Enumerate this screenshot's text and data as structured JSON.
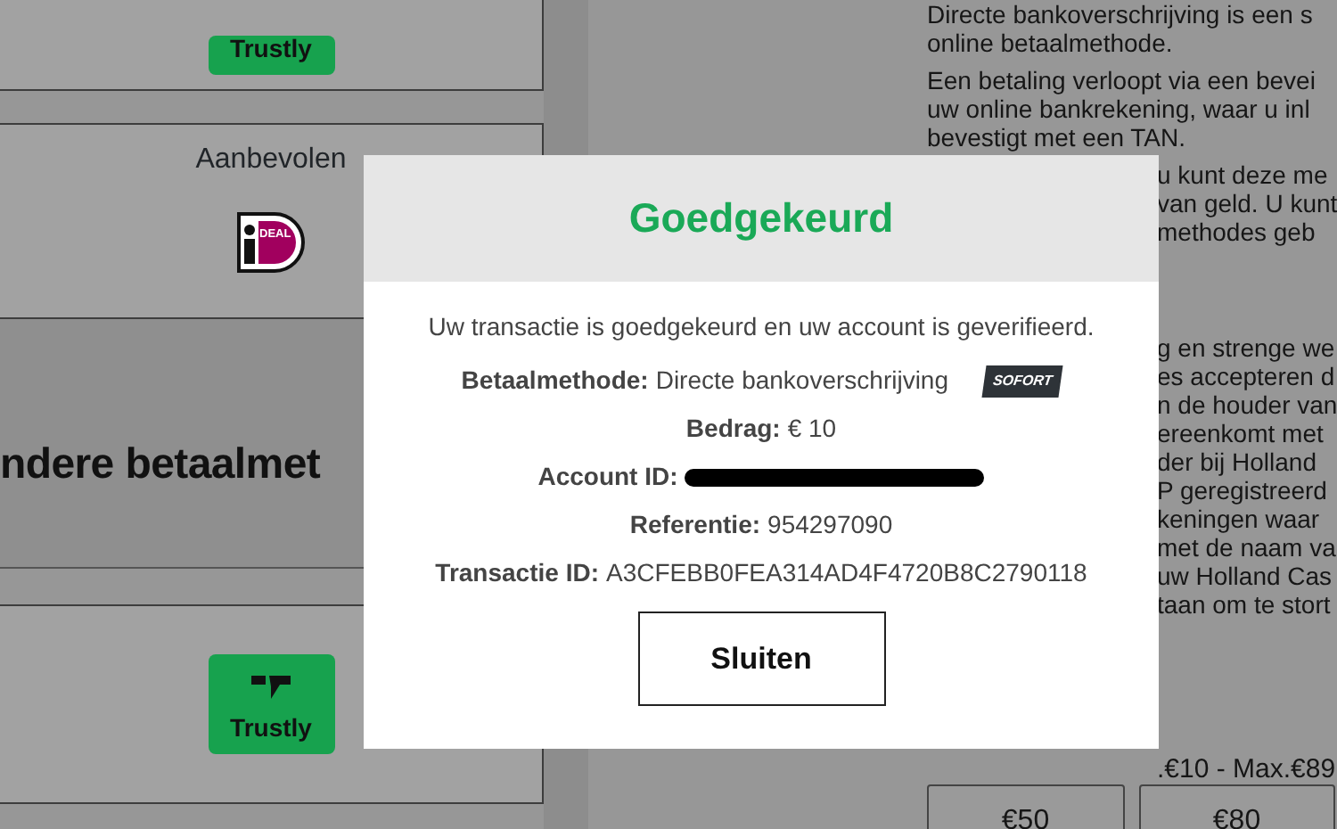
{
  "left_cards": [
    {
      "kind": "trustly",
      "logo_text": "Trustly"
    },
    {
      "kind": "ideal",
      "label": "Aanbevolen",
      "logo_text": "DEAL"
    }
  ],
  "section_heading": "ndere betaalmet",
  "bottom_card": {
    "kind": "trustly",
    "logo_text": "Trustly"
  },
  "info_paragraphs": [
    {
      "lines": [
        {
          "kind": "full",
          "text": "Directe bankoverschrijving is een s"
        },
        {
          "kind": "full",
          "text": "online betaalmethode."
        }
      ]
    },
    {
      "lines": [
        {
          "kind": "full",
          "text": "Een betaling verloopt via een bevei"
        },
        {
          "kind": "full",
          "text": "uw online bankrekening, waar u inl"
        },
        {
          "kind": "full",
          "text": "bevestigt met een TAN."
        }
      ]
    },
    {
      "lines": [
        {
          "kind": "partial",
          "text": "u kunt deze me"
        },
        {
          "kind": "partial",
          "text": "van geld. U kunt"
        },
        {
          "kind": "partial",
          "text": "methodes geb"
        }
      ]
    },
    {
      "lines": [
        {
          "kind": "partial",
          "text": "g en strenge we"
        },
        {
          "kind": "partial",
          "text": "es accepteren d"
        },
        {
          "kind": "partial",
          "text": "n de houder van"
        },
        {
          "kind": "partial",
          "text": "ereenkomt met"
        },
        {
          "kind": "partial",
          "text": "der bij Holland"
        },
        {
          "kind": "partial",
          "text": "P geregistreerd"
        },
        {
          "kind": "partial",
          "text": "keningen waar"
        },
        {
          "kind": "partial",
          "text": "met de naam va"
        },
        {
          "kind": "partial",
          "text": "uw Holland Cas"
        },
        {
          "kind": "partial",
          "text": "taan om te stort"
        }
      ]
    }
  ],
  "amount_range": ".€10 - Max.€89",
  "amount_buttons": [
    "€50",
    "€80"
  ],
  "modal": {
    "title": "Goedgekeurd",
    "message": "Uw transactie is goedgekeurd en uw account is geverifieerd.",
    "details": [
      {
        "label": "Betaalmethode:",
        "value": "Directe bankoverschrijving",
        "badge": "SOFORT"
      },
      {
        "label": "Bedrag:",
        "value": "€ 10"
      },
      {
        "label": "Account ID:",
        "redacted": true
      },
      {
        "label": "Referentie:",
        "value": "954297090"
      },
      {
        "label": "Transactie ID:",
        "value": "A3CFEBB0FEA314AD4F4720B8C2790118"
      }
    ],
    "button": "Sluiten"
  }
}
